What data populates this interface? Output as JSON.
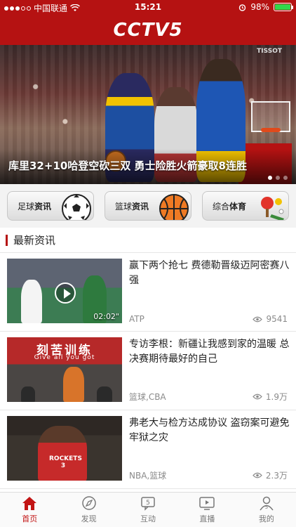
{
  "status": {
    "carrier": "中国联通",
    "time": "15:21",
    "battery": "98%",
    "battery_level": 0.98
  },
  "app": {
    "logo": "CCTV5"
  },
  "hero": {
    "caption": "库里32+10哈登空砍三双 勇士险胜火箭豪取8连胜",
    "tag": "TISSOT",
    "pages": 3,
    "active_page": 0
  },
  "categories": [
    {
      "prefix": "足球",
      "bold": "资讯",
      "icon": "soccer-ball-icon"
    },
    {
      "prefix": "篮球",
      "bold": "资讯",
      "icon": "basketball-icon"
    },
    {
      "prefix": "综合",
      "bold": "体育",
      "icon": "multi-sport-icon"
    }
  ],
  "section": {
    "title": "最新资讯"
  },
  "news": [
    {
      "title": "赢下两个抢七 费德勒晋级迈阿密赛八强",
      "meta": "ATP",
      "views": "9541",
      "duration": "02:02\"",
      "has_video": true
    },
    {
      "title": "专访李根：新疆让我感到家的温暖 总决赛期待最好的自己",
      "meta": "篮球,CBA",
      "views": "1.9万",
      "banner": "刻苦训练",
      "banner_sub": "Give all you got"
    },
    {
      "title": "弗老大与检方达成协议 盗窃案可避免牢狱之灾",
      "meta": "NBA,篮球",
      "views": "2.3万",
      "jersey": "ROCKETS 3"
    }
  ],
  "tabs": [
    {
      "label": "首页",
      "icon": "home-icon",
      "active": true
    },
    {
      "label": "发现",
      "icon": "compass-icon",
      "active": false
    },
    {
      "label": "互动",
      "icon": "chat-icon",
      "active": false
    },
    {
      "label": "直播",
      "icon": "tv-icon",
      "active": false
    },
    {
      "label": "我的",
      "icon": "profile-icon",
      "active": false
    }
  ],
  "colors": {
    "brand": "#b51212",
    "accent": "#c21414",
    "muted": "#8a8a8a"
  }
}
